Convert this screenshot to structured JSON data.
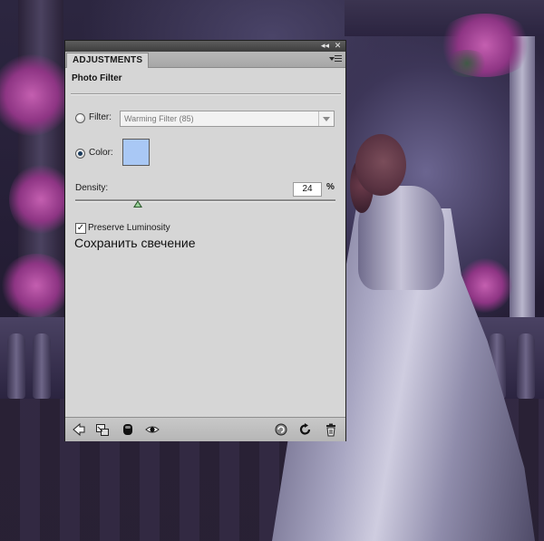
{
  "panel": {
    "tab_label": "ADJUSTMENTS",
    "adjustment_title": "Photo Filter",
    "filter_label": "Filter:",
    "filter_value": "Warming Filter (85)",
    "color_label": "Color:",
    "color_swatch": "#a9c8f5",
    "mode_selected": "color",
    "density_label": "Density:",
    "density_value": "24",
    "density_unit": "%",
    "density_fraction": 0.24,
    "preserve_label": "Preserve Luminosity",
    "preserve_checked": "✓",
    "annotation": "Сохранить свечение"
  },
  "topbar": {
    "collapse_glyph": "◂◂",
    "close_glyph": "✕"
  },
  "bottom_icons": [
    "back-arrow-icon",
    "clip-layer-icon",
    "layer-visibility-mask-icon",
    "eye-icon",
    "reset-previous-icon",
    "reset-icon",
    "trash-icon"
  ]
}
